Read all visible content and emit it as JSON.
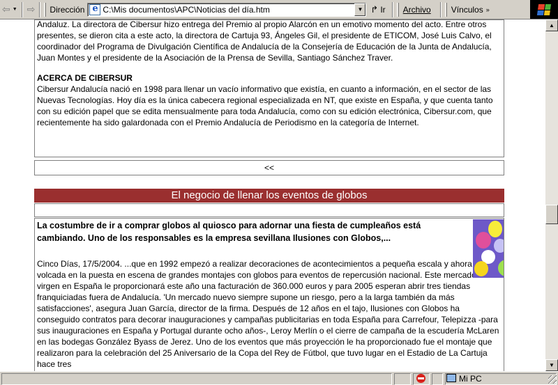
{
  "toolbar": {
    "address_label": "Dirección",
    "address_value": "C:\\Mis documentos\\APC\\Noticias del día.htm",
    "go_label": "Ir",
    "archivo_label": "Archivo",
    "vinculos_label": "Vínculos"
  },
  "article1": {
    "para1": "Andaluz. La directora de Cibersur hizo entrega del Premio al propio Alarcón en un emotivo momento del acto. Entre otros presentes, se dieron cita a este acto, la directora de Cartuja 93, Ángeles Gil, el presidente de ETICOM, José Luis Calvo, el coordinador del Programa de Divulgación Científica de Andalucía de la Consejería de Educación de la Junta de Andalucía, Juan Montes y el presidente de la Asociación de la Prensa de Sevilla, Santiago Sánchez Traver.",
    "heading": "ACERCA DE CIBERSUR",
    "para2": "Cibersur Andalucía nació en 1998 para llenar un vacío informativo que existía, en cuanto a información, en el sector de las Nuevas Tecnologías. Hoy día es la única cabecera regional especializada en NT, que existe en España, y que cuenta tanto con su edición papel que se edita mensualmente para toda Andalucía, como con su edición electrónica, Cibersur.com, que recientemente ha sido galardonada con el Premio Andalucía de Periodismo en la categoría de Internet.",
    "back_link": "<<"
  },
  "article2": {
    "title": "El negocio de llenar los eventos de globos",
    "lead": "La costumbre de ir a comprar globos al quiosco para adornar una fiesta de cumpleaños está cambiando. Uno de los responsables es la empresa sevillana Ilusiones con Globos,...",
    "body": "Cinco Días, 17/5/2004. ...que en 1992 empezó a realizar decoraciones de acontecimientos a pequeña escala y ahora está volcada en la puesta en escena de grandes montajes con globos para eventos de repercusión nacional. Este mercado casi virgen en España le proporcionará este año una facturación de 360.000 euros y para 2005 esperan abrir tres tiendas franquiciadas fuera de Andalucía. 'Un mercado nuevo siempre supone un riesgo, pero a la larga también da más satisfacciones', asegura Juan García, director de la firma. Después de 12 años en el tajo, Ilusiones con Globos ha conseguido contratos para decorar inauguraciones y campañas publicitarias en toda España para Carrefour, Telepizza -para sus inauguraciones en España y Portugal durante ocho años-, Leroy Merlín o el cierre de campaña de la escudería McLaren en las bodegas González Byass de Jerez. Uno de los eventos que más proyección le ha proporcionado fue el montaje que realizaron para la celebración del 25 Aniversario de la Copa del Rey de Fútbol, que tuvo lugar en el Estadio de La Cartuja hace tres"
  },
  "status": {
    "zone": "Mi PC"
  },
  "colors": {
    "title_bar": "#9a2f2f"
  }
}
